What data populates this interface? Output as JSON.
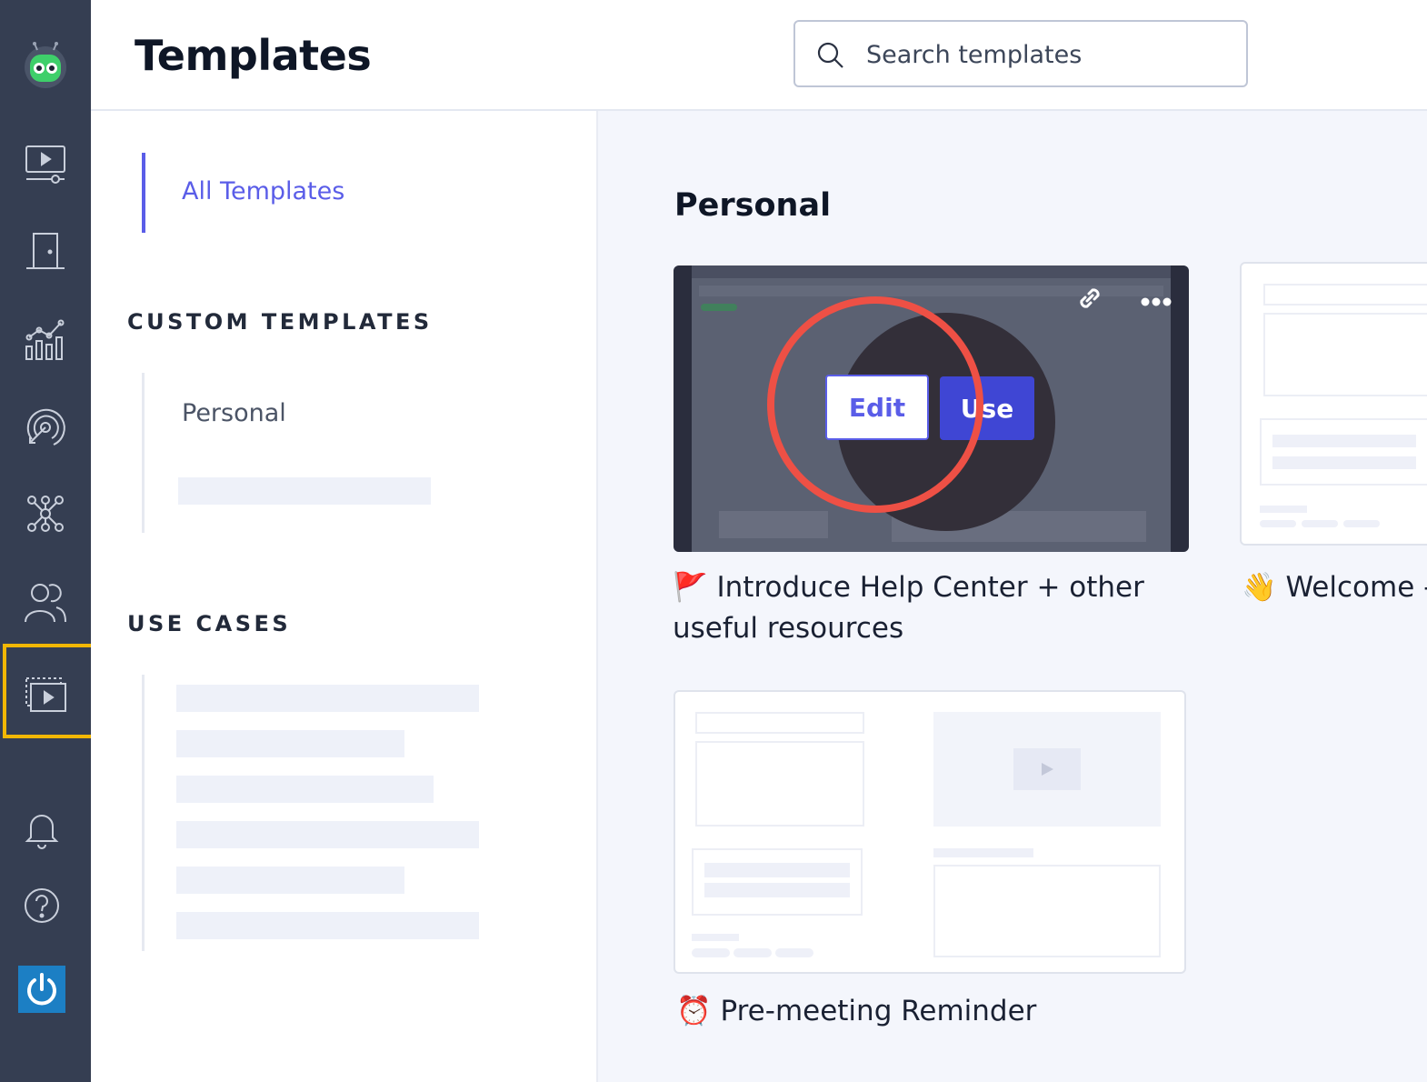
{
  "header": {
    "title": "Templates",
    "search_placeholder": "Search templates"
  },
  "leftnav": {
    "all_templates": "All Templates",
    "custom_templates_title": "CUSTOM TEMPLATES",
    "custom_items": [
      "Personal"
    ],
    "use_cases_title": "USE CASES"
  },
  "main": {
    "section_heading": "Personal",
    "templates": [
      {
        "emoji": "🚩",
        "title": "Introduce Help Center + other useful resources",
        "edit_label": "Edit",
        "use_label": "Use"
      },
      {
        "emoji": "👋",
        "title": "Welcome --"
      },
      {
        "emoji": "⏰",
        "title": "Pre-meeting Reminder"
      }
    ]
  },
  "colors": {
    "sidebar_bg": "#353e52",
    "accent": "#5a5de8",
    "use_button": "#3f46d4",
    "highlight": "#f2b705",
    "annotation_ring": "#ee5045"
  },
  "sidebar_icons": [
    "robot-logo-icon",
    "video-library-icon",
    "door-icon",
    "analytics-icon",
    "target-icon",
    "integrations-icon",
    "team-icon",
    "templates-icon",
    "bell-icon",
    "help-icon",
    "power-icon"
  ]
}
